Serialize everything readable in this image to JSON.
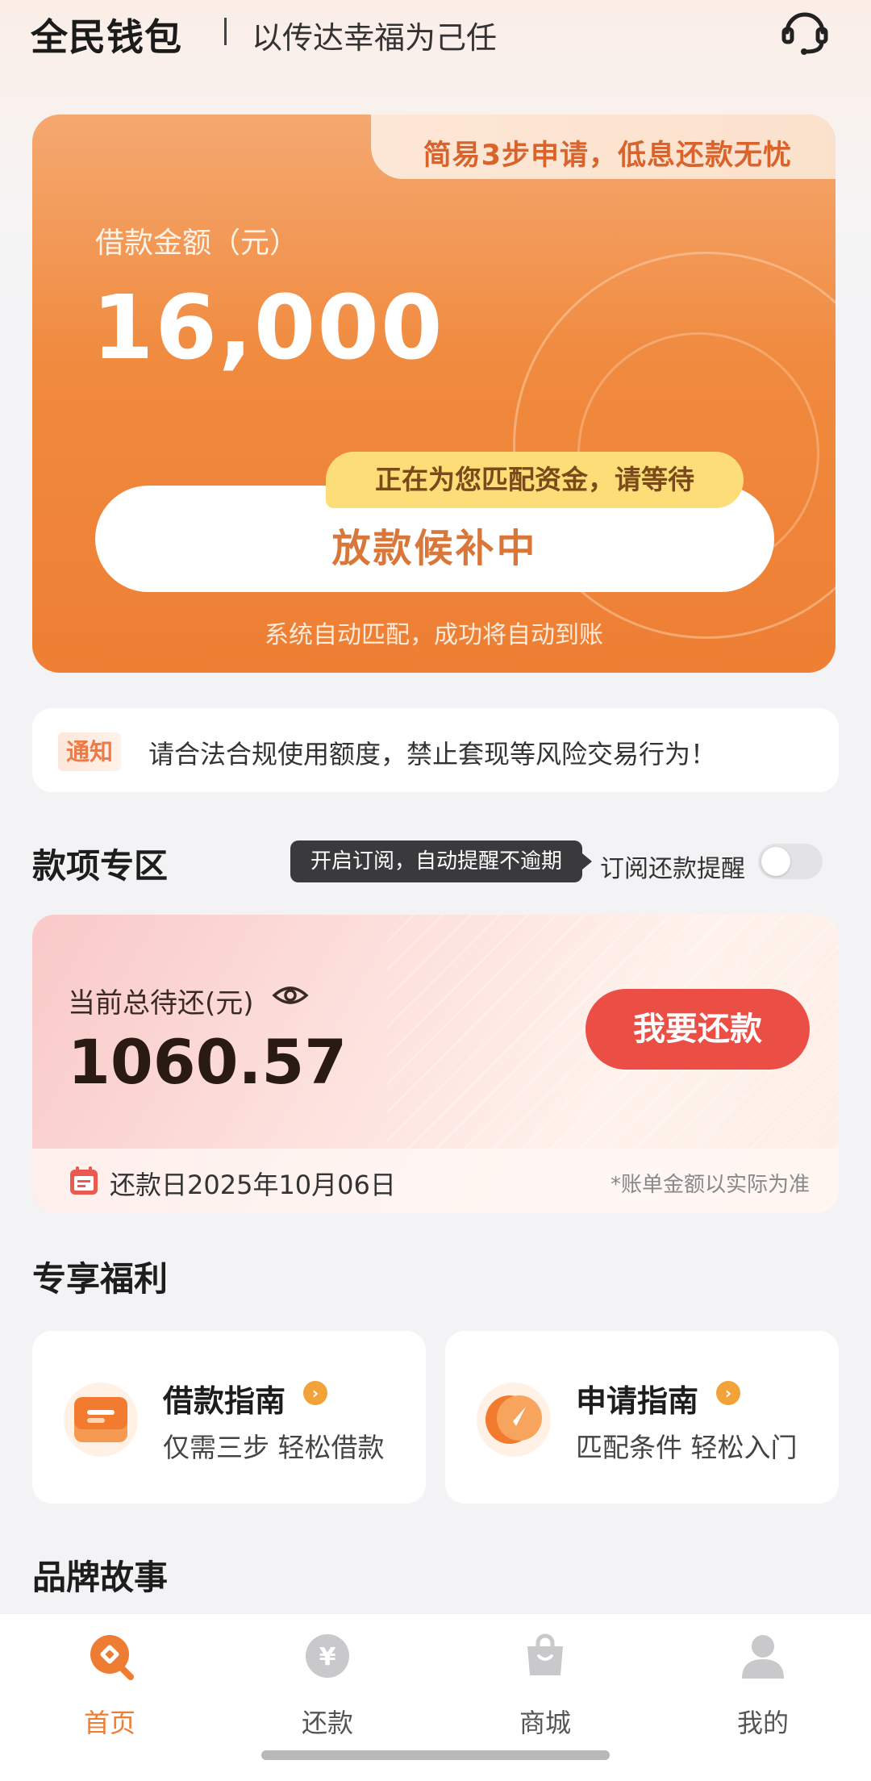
{
  "header": {
    "brand": "全民钱包",
    "slogan": "以传达幸福为己任",
    "support_icon": "headset-icon"
  },
  "loan_card": {
    "tab_text": "简易3步申请，低息还款无忧",
    "amount_label": "借款金额（元）",
    "amount": "16,000",
    "match_badge": "正在为您匹配资金，请等待",
    "status": "放款候补中",
    "footer": "系统自动匹配，成功将自动到账"
  },
  "notice": {
    "tag": "通知",
    "text": "请合法合规使用额度，禁止套现等风险交易行为！"
  },
  "payment_zone": {
    "title": "款项专区",
    "tooltip": "开启订阅，自动提醒不逾期",
    "subscribe_label": "订阅还款提醒",
    "subscribe_on": false,
    "repay_label": "当前总待还(元)",
    "repay_amount": "1060.57",
    "repay_button": "我要还款",
    "due_date": "还款日2025年10月06日",
    "bill_note": "*账单金额以实际为准"
  },
  "benefits": {
    "title": "专享福利",
    "cards": [
      {
        "title": "借款指南",
        "subtitle": "仅需三步 轻松借款",
        "icon": "ticket-icon"
      },
      {
        "title": "申请指南",
        "subtitle": "匹配条件 轻松入门",
        "icon": "compass-icon"
      }
    ]
  },
  "brand_story": {
    "title": "品牌故事"
  },
  "nav": {
    "items": [
      {
        "label": "首页",
        "icon": "home-icon",
        "active": true
      },
      {
        "label": "还款",
        "icon": "yuan-icon",
        "active": false
      },
      {
        "label": "商城",
        "icon": "shopping-bag-icon",
        "active": false
      },
      {
        "label": "我的",
        "icon": "user-icon",
        "active": false
      }
    ]
  },
  "colors": {
    "accent": "#ee7c33",
    "repay_button": "#ea4e45",
    "badge": "#fddd77"
  }
}
